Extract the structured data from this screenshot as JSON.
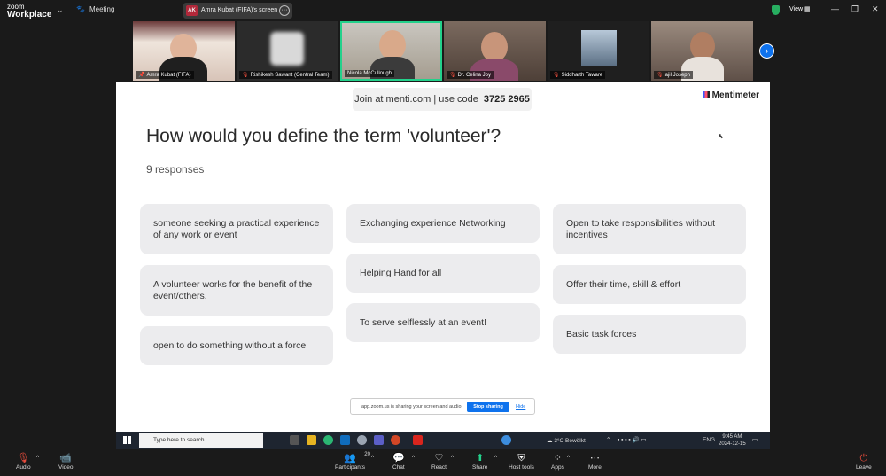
{
  "app": {
    "brand_top": "zoom",
    "brand_bottom": "Workplace",
    "meeting_label": "Meeting",
    "share_initials": "AK",
    "share_title": "Amra Kubat (FIFA)'s screen",
    "view_label": "View"
  },
  "participants": [
    {
      "name": "Amra Kubat (FIFA)"
    },
    {
      "name": "Rishikesh Sawant (Central Team)"
    },
    {
      "name": "Nicola McCullough"
    },
    {
      "name": "Dr. Celina Joy"
    },
    {
      "name": "Siddharth Taware"
    },
    {
      "name": "ajil Joseph"
    }
  ],
  "slide": {
    "join_text": "Join at menti.com | use code",
    "code": "3725 2965",
    "brand": "Mentimeter",
    "question": "How would you define the term 'volunteer'?",
    "responses_count": "9 responses",
    "cards": [
      "someone seeking a practical experience of any work or event",
      "A volunteer works for the benefit of the event/others.",
      "open to do something without a force",
      "Exchanging experience Networking",
      "Helping Hand for all",
      "To serve selflessly at an event!",
      "Open to take responsibilities without incentives",
      "Offer their time, skill & effort",
      "Basic task forces"
    ]
  },
  "sharebar": {
    "message": "app.zoom.us is sharing your screen and audio.",
    "stop": "Stop sharing",
    "hide": "Hide"
  },
  "taskbar": {
    "search_placeholder": "Type here to search",
    "weather": "3°C  Bewölkt",
    "lang": "ENG",
    "time": "9:45 AM",
    "date": "2024-12-15"
  },
  "controls": {
    "audio": "Audio",
    "video": "Video",
    "participants": "Participants",
    "participants_count": "20",
    "chat": "Chat",
    "react": "React",
    "share": "Share",
    "host_tools": "Host tools",
    "apps": "Apps",
    "more": "More",
    "leave": "Leave"
  },
  "colors": {
    "accent": "#0e72ed",
    "active_speaker": "#23d18b",
    "muted": "#e74c3c",
    "card_bg": "#ececee"
  }
}
